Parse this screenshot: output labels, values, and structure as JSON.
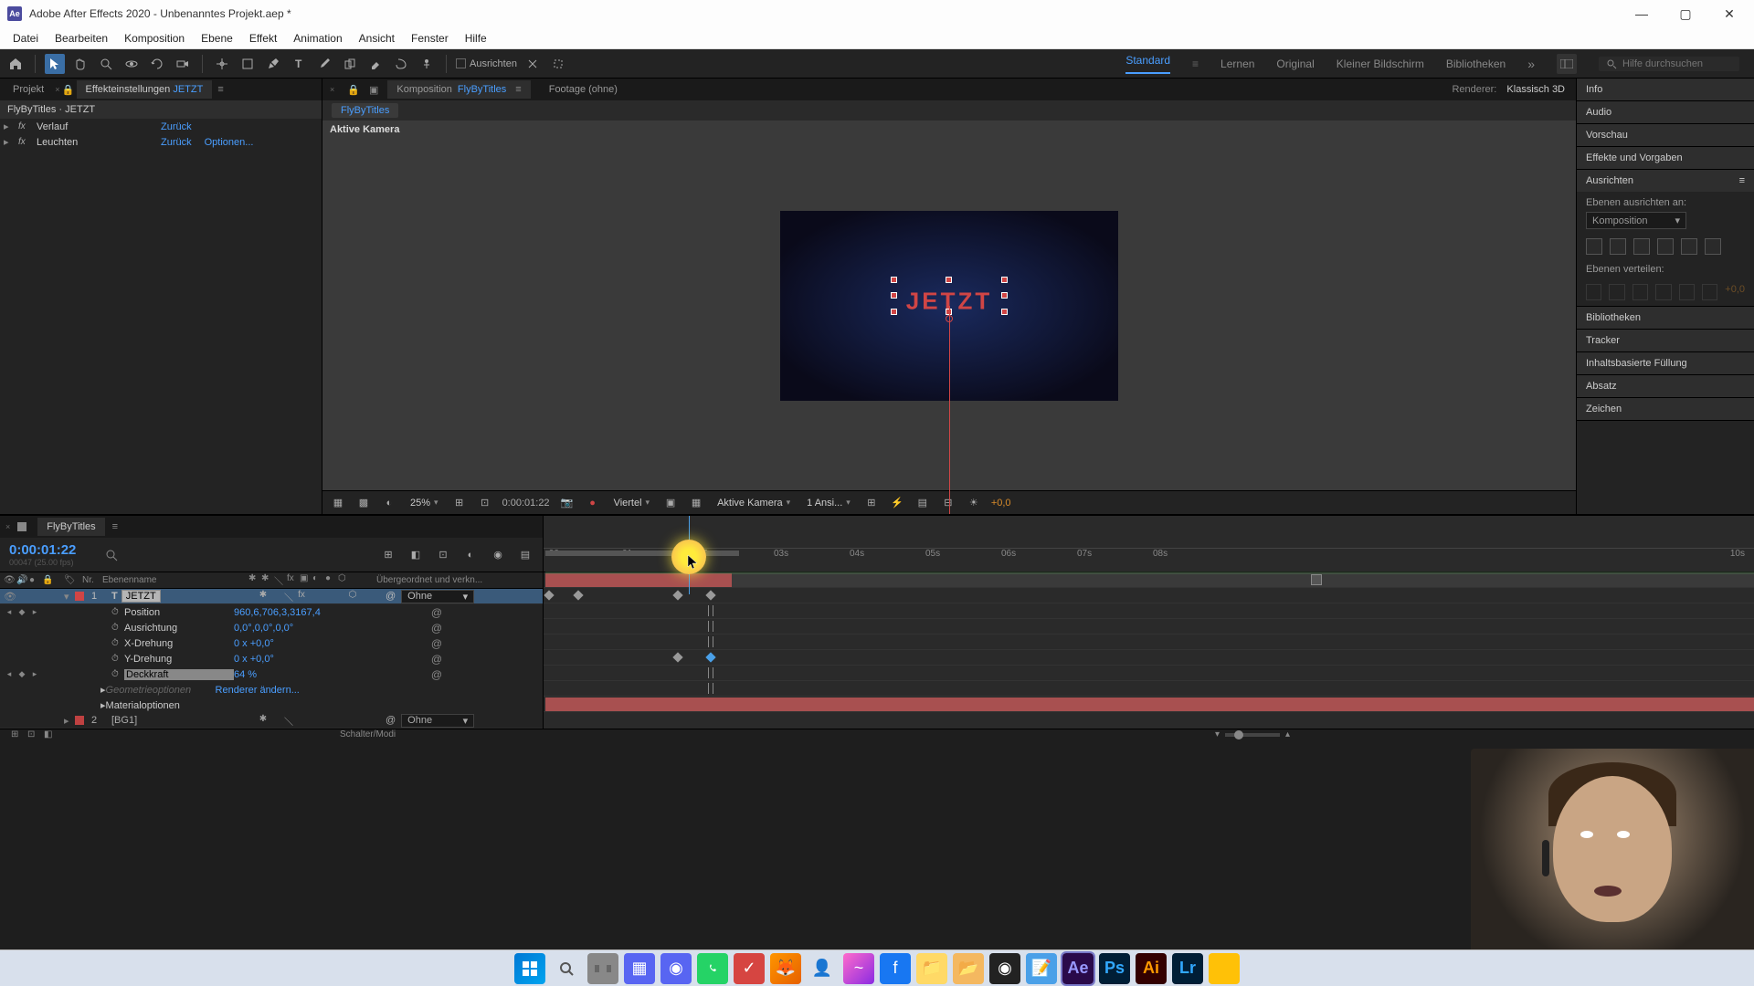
{
  "titlebar": {
    "app_icon_label": "Ae",
    "title": "Adobe After Effects 2020 - Unbenanntes Projekt.aep *"
  },
  "menubar": {
    "items": [
      "Datei",
      "Bearbeiten",
      "Komposition",
      "Ebene",
      "Effekt",
      "Animation",
      "Ansicht",
      "Fenster",
      "Hilfe"
    ]
  },
  "toolbar": {
    "align_label": "Ausrichten",
    "workspaces": [
      "Standard",
      "Lernen",
      "Original",
      "Kleiner Bildschirm",
      "Bibliotheken"
    ],
    "search_placeholder": "Hilfe durchsuchen"
  },
  "left_panel": {
    "tab_project": "Projekt",
    "tab_effect": "Effekteinstellungen",
    "tab_effect_link": "JETZT",
    "header": "FlyByTitles · JETZT",
    "effects": [
      {
        "name": "Verlauf",
        "reset": "Zurück",
        "options": ""
      },
      {
        "name": "Leuchten",
        "reset": "Zurück",
        "options": "Optionen..."
      }
    ]
  },
  "center_panel": {
    "tab_comp": "Komposition",
    "tab_comp_link": "FlyByTitles",
    "tab_footage": "Footage  (ohne)",
    "renderer_label": "Renderer:",
    "renderer_value": "Klassisch 3D",
    "breadcrumb": "FlyByTitles",
    "camera_label": "Aktive Kamera",
    "canvas_text": "JETZT",
    "footer": {
      "zoom": "25%",
      "timecode": "0:00:01:22",
      "resolution": "Viertel",
      "view": "Aktive Kamera",
      "views": "1 Ansi...",
      "exposure": "+0,0"
    }
  },
  "right_panel": {
    "sections": [
      "Info",
      "Audio",
      "Vorschau",
      "Effekte und Vorgaben"
    ],
    "align_header": "Ausrichten",
    "align_label": "Ebenen ausrichten an:",
    "align_dropdown": "Komposition",
    "distribute_label": "Ebenen verteilen:",
    "distribute_val": "+0,0",
    "bottom_sections": [
      "Bibliotheken",
      "Tracker",
      "Inhaltsbasierte Füllung",
      "Absatz",
      "Zeichen"
    ]
  },
  "timeline": {
    "tab": "FlyByTitles",
    "timecode": "0:00:01:22",
    "frame_info": "00047 (25.00 fps)",
    "col_num": "Nr.",
    "col_name": "Ebenenname",
    "col_parent": "Übergeordnet und verkn...",
    "layer1": {
      "num": "1",
      "name": "JETZT",
      "type_icon": "T",
      "parent": "Ohne",
      "props": {
        "position": {
          "name": "Position",
          "value": "960,6,706,3,3167,4"
        },
        "orientation": {
          "name": "Ausrichtung",
          "value": "0,0°,0,0°,0,0°"
        },
        "xrot": {
          "name": "X-Drehung",
          "value": "0 x +0,0°"
        },
        "yrot": {
          "name": "Y-Drehung",
          "value": "0 x +0,0°"
        },
        "opacity": {
          "name": "Deckkraft",
          "value": "64 %"
        },
        "geometry": {
          "name": "Geometrieoptionen",
          "value": "Renderer ändern..."
        },
        "material": {
          "name": "Materialoptionen"
        }
      }
    },
    "layer2": {
      "num": "2",
      "name": "[BG1]",
      "parent": "Ohne"
    },
    "ruler_ticks": [
      ":00s",
      "01s",
      "02s",
      "03s",
      "04s",
      "05s",
      "06s",
      "07s",
      "08s"
    ],
    "ruler_end": "10s",
    "footer_label": "Schalter/Modi"
  }
}
